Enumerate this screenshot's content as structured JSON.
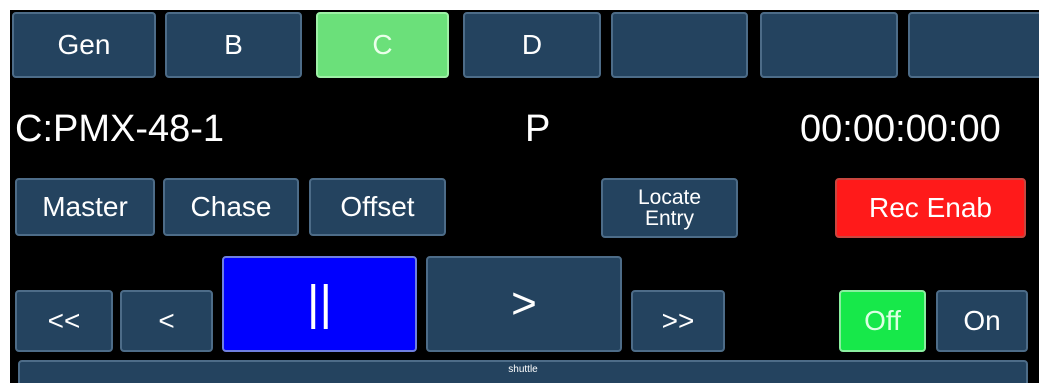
{
  "tabs": [
    {
      "label": "Gen"
    },
    {
      "label": "B"
    },
    {
      "label": "C"
    },
    {
      "label": "D"
    },
    {
      "label": ""
    },
    {
      "label": ""
    },
    {
      "label": ""
    }
  ],
  "status": {
    "source": "C:PMX-48-1",
    "mode": "P",
    "timecode": "00:00:00:00"
  },
  "controls": {
    "master": "Master",
    "chase": "Chase",
    "offset": "Offset",
    "locate_line1": "Locate",
    "locate_line2": "Entry",
    "rec_enable": "Rec Enab"
  },
  "transport": {
    "rewind_fast": "<<",
    "rewind": "<",
    "pause": "||",
    "play": ">",
    "forward_fast": ">>"
  },
  "toggle": {
    "off": "Off",
    "on": "On"
  },
  "shuttle": {
    "label": "shuttle"
  },
  "colors": {
    "panel_bg": "#000000",
    "button_bg": "#24435f",
    "active_tab": "#6be07a",
    "rec_enable": "#ff1a1a",
    "pause_active": "#0000ff",
    "off_active": "#17e84a"
  }
}
